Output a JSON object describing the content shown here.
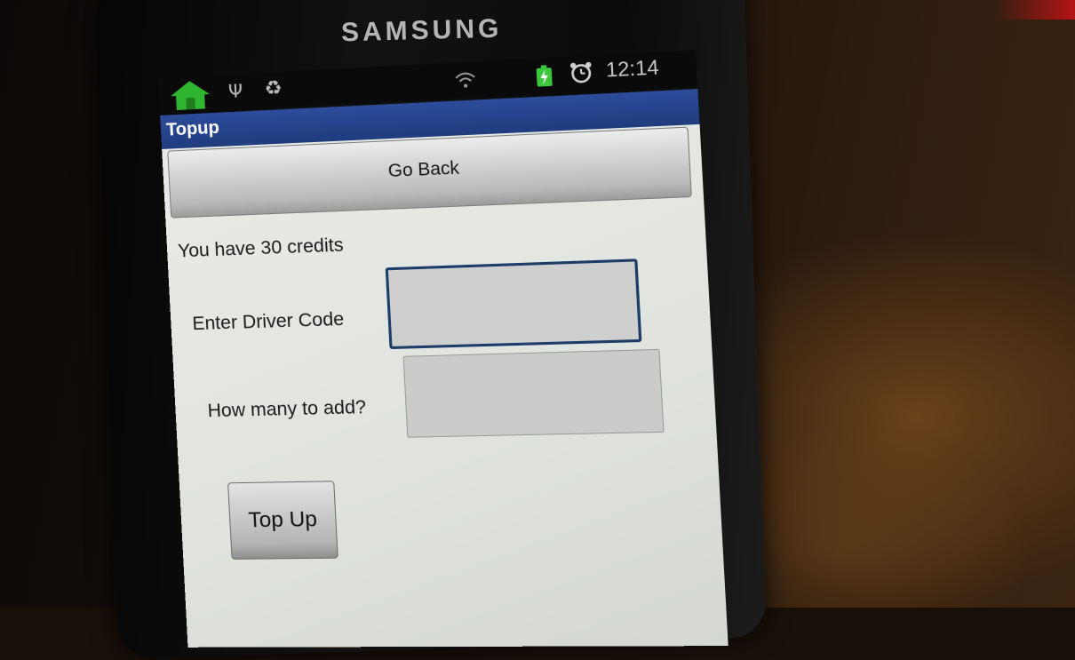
{
  "device": {
    "brand": "SAMSUNG"
  },
  "status_bar": {
    "time": "12:14",
    "icons": [
      "home-icon",
      "usb-icon",
      "recycle-icon",
      "wifi-icon",
      "battery-charging-icon",
      "alarm-icon"
    ],
    "colors": {
      "home_icon": "#2fb52f",
      "battery_icon": "#3cc83c"
    }
  },
  "app": {
    "title": "Topup",
    "go_back_label": "Go Back",
    "credits_text": "You have 30 credits",
    "driver_code_label": "Enter Driver Code",
    "driver_code_value": "",
    "amount_label": "How many to add?",
    "amount_value": "",
    "top_up_label": "Top Up"
  },
  "colors": {
    "title_bar": "#2a4a96",
    "input_focus_border": "#1d3d68"
  }
}
